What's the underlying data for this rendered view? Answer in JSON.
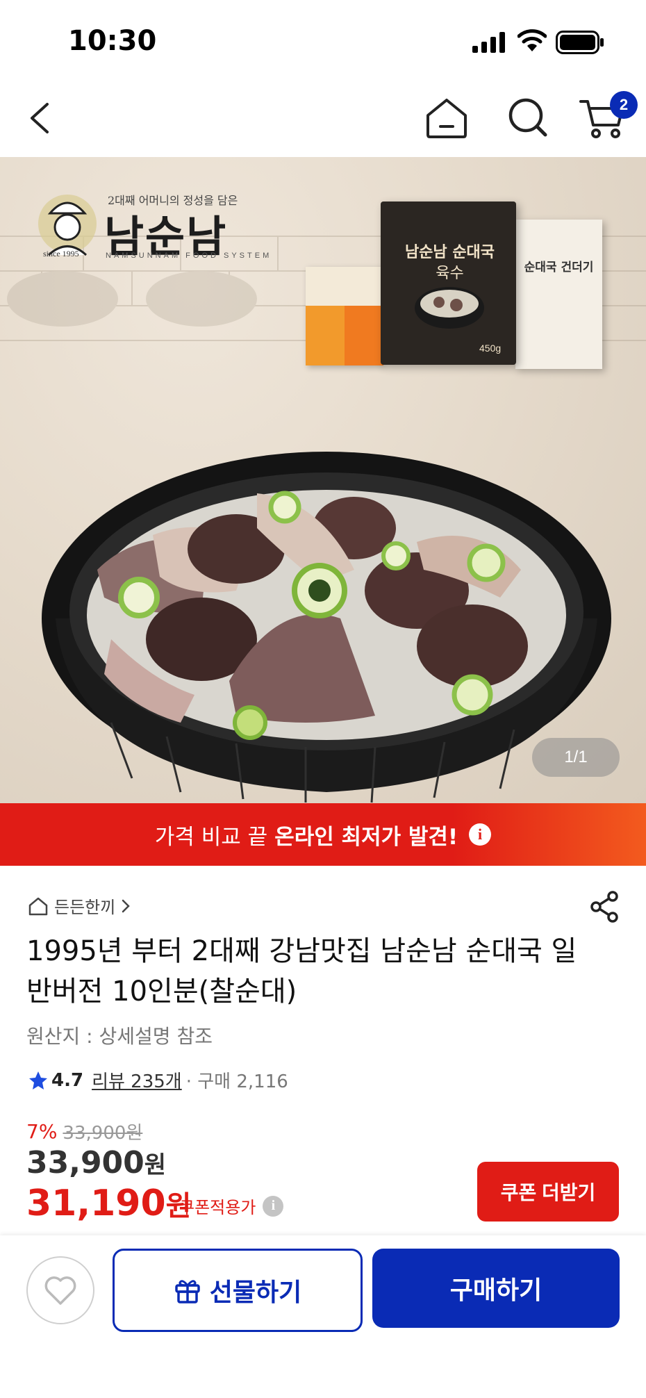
{
  "status_bar": {
    "time": "10:30"
  },
  "header": {
    "cart_count": "2"
  },
  "hero": {
    "brand_tagline": "2대째 어머니의 정성을 담은",
    "brand_name": "남순남",
    "brand_subtitle": "NAMSUNNAM FOOD SYSTEM",
    "brand_since": "since 1995",
    "package_title": "남순남 순대국",
    "package_sub": "육수",
    "package_weight": "450g",
    "package_right_label": "순대국 건더기",
    "image_counter": "1/1"
  },
  "promo": {
    "prefix": "가격 비교 끝",
    "highlight": "온라인 최저가 발견!",
    "info_icon": "i"
  },
  "product": {
    "category": "든든한끼",
    "title": "1995년 부터 2대째 강남맛집 남순남 순대국 일반버전 10인분(찰순대)",
    "origin": "원산지 : 상세설명 참조",
    "rating": "4.7",
    "reviews": "리뷰 235개",
    "purchases": "· 구매 2,116"
  },
  "price": {
    "discount_rate": "7%",
    "original_price": "33,900원",
    "sale_price": "33,900",
    "sale_unit": "원",
    "coupon_price": "31,190",
    "coupon_unit": "원",
    "coupon_label": "쿠폰적용가",
    "coupon_info_icon": "i",
    "coupon_button": "쿠폰 더받기"
  },
  "actions": {
    "gift_label": "선물하기",
    "buy_label": "구매하기"
  },
  "colors": {
    "brand_blue": "#0a2bb5",
    "sale_red": "#e01c16"
  },
  "icons": [
    "back-icon",
    "home-icon",
    "search-icon",
    "cart-icon",
    "share-icon",
    "heart-icon",
    "gift-icon",
    "star-icon",
    "house-icon",
    "chevron-right-icon",
    "info-icon"
  ]
}
